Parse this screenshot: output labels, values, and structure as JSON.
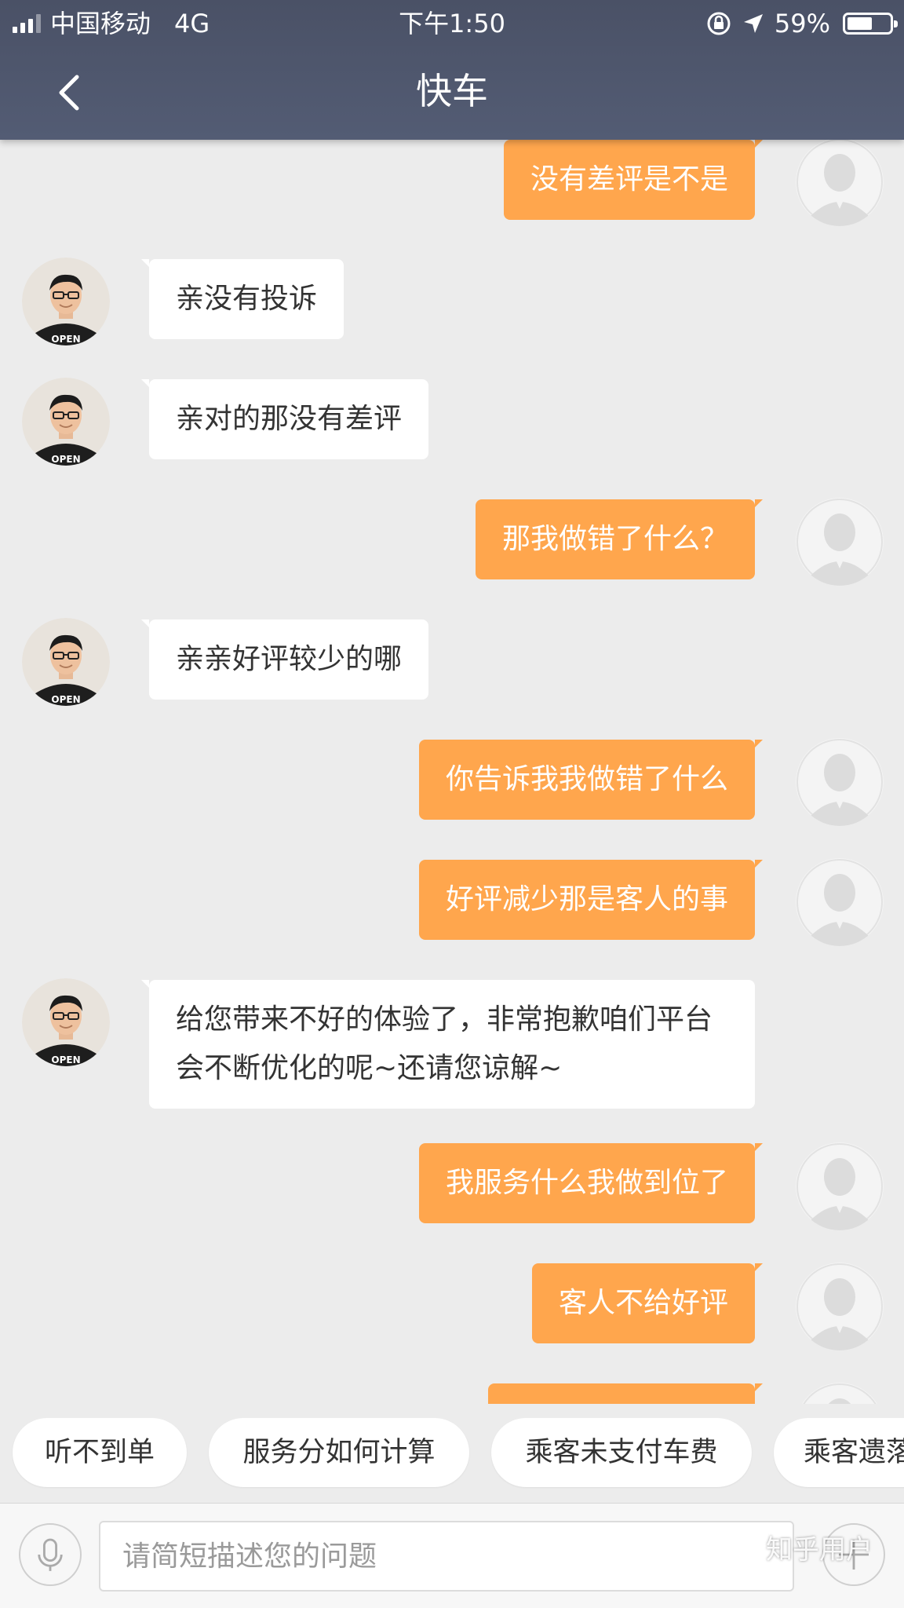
{
  "status_bar": {
    "carrier": "中国移动",
    "network": "4G",
    "time": "下午1:50",
    "battery": "59%",
    "battery_level": 0.59
  },
  "header": {
    "title": "快车",
    "back_icon": "chevron-left-icon"
  },
  "messages": [
    {
      "from": "user",
      "text": "没有差评是不是"
    },
    {
      "from": "agent",
      "text": "亲没有投诉"
    },
    {
      "from": "agent",
      "text": "亲对的那没有差评"
    },
    {
      "from": "user",
      "text": "那我做错了什么？"
    },
    {
      "from": "agent",
      "text": "亲亲好评较少的哪"
    },
    {
      "from": "user",
      "text": "你告诉我我做错了什么"
    },
    {
      "from": "user",
      "text": "好评减少那是客人的事"
    },
    {
      "from": "agent",
      "text": "给您带来不好的体验了，非常抱歉咱们平台会不断优化的呢~还请您谅解~"
    },
    {
      "from": "user",
      "text": "我服务什么我做到位了"
    },
    {
      "from": "user",
      "text": "客人不给好评"
    }
  ],
  "quick_replies": [
    "听不到单",
    "服务分如何计算",
    "乘客未支付车费",
    "乘客遗落"
  ],
  "input": {
    "placeholder": "请简短描述您的问题",
    "value": ""
  },
  "watermark": "知乎用户",
  "colors": {
    "header_bg": "#4f576e",
    "outgoing_bubble": "#ffa64d",
    "incoming_bubble": "#ffffff",
    "chat_bg": "#ececec"
  }
}
